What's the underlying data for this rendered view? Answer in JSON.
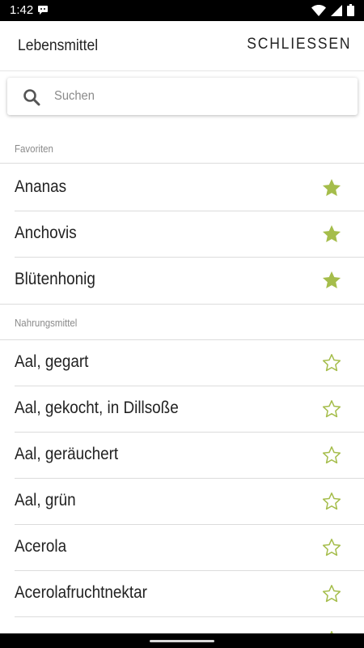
{
  "status_bar": {
    "time": "1:42",
    "notification_icon": "message-bubble-icon",
    "icons": [
      "wifi-icon",
      "signal-icon",
      "battery-icon"
    ]
  },
  "app_bar": {
    "title": "Lebensmittel",
    "close_label": "SCHLIESSEN"
  },
  "search": {
    "placeholder": "Suchen",
    "value": "",
    "icon": "search-icon"
  },
  "sections": [
    {
      "title": "Favoriten",
      "items": [
        {
          "label": "Ananas",
          "favorite": true
        },
        {
          "label": "Anchovis",
          "favorite": true
        },
        {
          "label": "Blütenhonig",
          "favorite": true
        }
      ]
    },
    {
      "title": "Nahrungsmittel",
      "items": [
        {
          "label": "Aal, gegart",
          "favorite": false
        },
        {
          "label": "Aal, gekocht, in Dillsoße",
          "favorite": false
        },
        {
          "label": "Aal, geräuchert",
          "favorite": false
        },
        {
          "label": "Aal, grün",
          "favorite": false
        },
        {
          "label": "Acerola",
          "favorite": false
        },
        {
          "label": "Acerolafruchtnektar",
          "favorite": false
        },
        {
          "label": "",
          "favorite": false
        }
      ]
    }
  ],
  "colors": {
    "accent_star": "#a5bd4b",
    "text": "#222222",
    "subtle_text": "#8a8a8a",
    "divider": "#dcdcdc"
  }
}
